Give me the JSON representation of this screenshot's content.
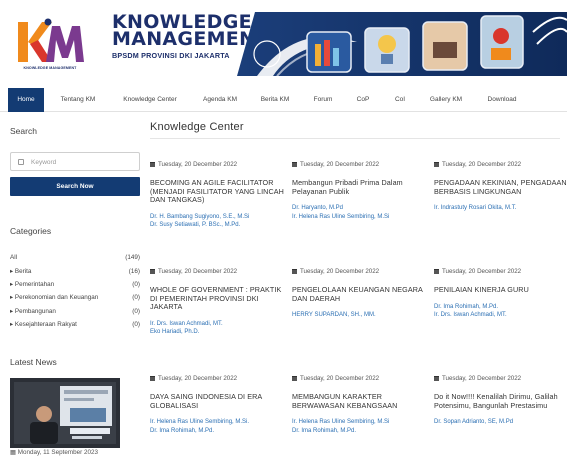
{
  "header": {
    "logo_caption": "KNOWLEDGE MANAGEMENT",
    "brand_line1": "KNOWLEDGE",
    "brand_line2": "MANAGEMENT",
    "brand_sub": "BPSDM PROVINSI DKI JAKARTA",
    "colors": {
      "navy": "#1d2f6b",
      "orange": "#f08a1c",
      "red": "#d9362c",
      "purple": "#7b3a8f"
    }
  },
  "nav": {
    "items": [
      {
        "label": "Home",
        "active": true
      },
      {
        "label": "Tentang KM",
        "active": false
      },
      {
        "label": "Knowledge Center",
        "active": false
      },
      {
        "label": "Agenda KM",
        "active": false
      },
      {
        "label": "Berita KM",
        "active": false
      },
      {
        "label": "Forum",
        "active": false
      },
      {
        "label": "CoP",
        "active": false
      },
      {
        "label": "CoI",
        "active": false
      },
      {
        "label": "Gallery KM",
        "active": false
      },
      {
        "label": "Download",
        "active": false
      }
    ],
    "active_color": "#133b73"
  },
  "sidebar": {
    "search_title": "Search",
    "search_placeholder": "Keyword",
    "search_button": "Search Now",
    "categories_title": "Categories",
    "categories": [
      {
        "label": "All",
        "count": "(149)"
      },
      {
        "label": "▸ Berita",
        "count": "(16)"
      },
      {
        "label": "▸ Pemerintahan",
        "count": "(0)"
      },
      {
        "label": "▸ Perekonomian dan Keuangan",
        "count": "(0)"
      },
      {
        "label": "▸ Pembangunan",
        "count": "(0)"
      },
      {
        "label": "▸ Kesejahteraan Rakyat",
        "count": "(0)"
      }
    ],
    "news_title": "Latest News",
    "news_date": "Monday, 11 September 2023"
  },
  "main": {
    "title": "Knowledge Center",
    "articles": [
      {
        "date": "Tuesday, 20 December 2022",
        "title": "BECOMING AN AGILE FACILITATOR (MENJADI FASILITATOR YANG LINCAH DAN TANGKAS)",
        "authors": [
          "Dr. H. Bambang Sugiyono, S.E., M.Si",
          "Dr. Susy Setiawati, P. BSc., M.Pd."
        ]
      },
      {
        "date": "Tuesday, 20 December 2022",
        "title": "Membangun Pribadi Prima Dalam Pelayanan Publik",
        "authors": [
          "Dr. Haryanto, M.Pd",
          "Ir. Helena Ras Uline Sembiring, M.Si"
        ]
      },
      {
        "date": "Tuesday, 20 December 2022",
        "title": "PENGADAAN KEKINIAN, PENGADAAN BERBASIS LINGKUNGAN",
        "authors": [
          "Ir. Indrastuty Rosari Okita, M.T."
        ]
      },
      {
        "date": "Tuesday, 20 December 2022",
        "title": "WHOLE OF GOVERNMENT : PRAKTIK DI PEMERINTAH PROVINSI DKI JAKARTA",
        "authors": [
          "Ir. Drs. Iswan Achmadi, MT.",
          "Eko Hariadi, Ph.D."
        ]
      },
      {
        "date": "Tuesday, 20 December 2022",
        "title": "PENGELOLAAN KEUANGAN NEGARA DAN DAERAH",
        "authors": [
          "HERRY SUPARDAN, SH., MM."
        ]
      },
      {
        "date": "Tuesday, 20 December 2022",
        "title": "PENILAIAN KINERJA GURU",
        "authors": [
          "Dr. Ima Rohimah, M.Pd.",
          "Ir. Drs. Iswan Achmadi, MT."
        ]
      },
      {
        "date": "Tuesday, 20 December 2022",
        "title": "DAYA SAING INDONESIA DI ERA GLOBALISASI",
        "authors": [
          "Ir. Helena Ras Uline Sembiring, M.Si.",
          "Dr. Ima Rohimah, M.Pd."
        ]
      },
      {
        "date": "Tuesday, 20 December 2022",
        "title": "MEMBANGUN KARAKTER BERWAWASAN KEBANGSAAN",
        "authors": [
          "Ir. Helena Ras Uline Sembiring, M.Si",
          "Dr. Ima Rohimah, M.Pd."
        ]
      },
      {
        "date": "Tuesday, 20 December 2022",
        "title": "Do it Now!!!! Kenalilah Dirimu, Galilah Potensimu, Bangunlah Prestasimu",
        "authors": [
          "Dr. Sopan Adrianto, SE, M.Pd"
        ]
      }
    ],
    "link_color": "#2b6fb3"
  }
}
